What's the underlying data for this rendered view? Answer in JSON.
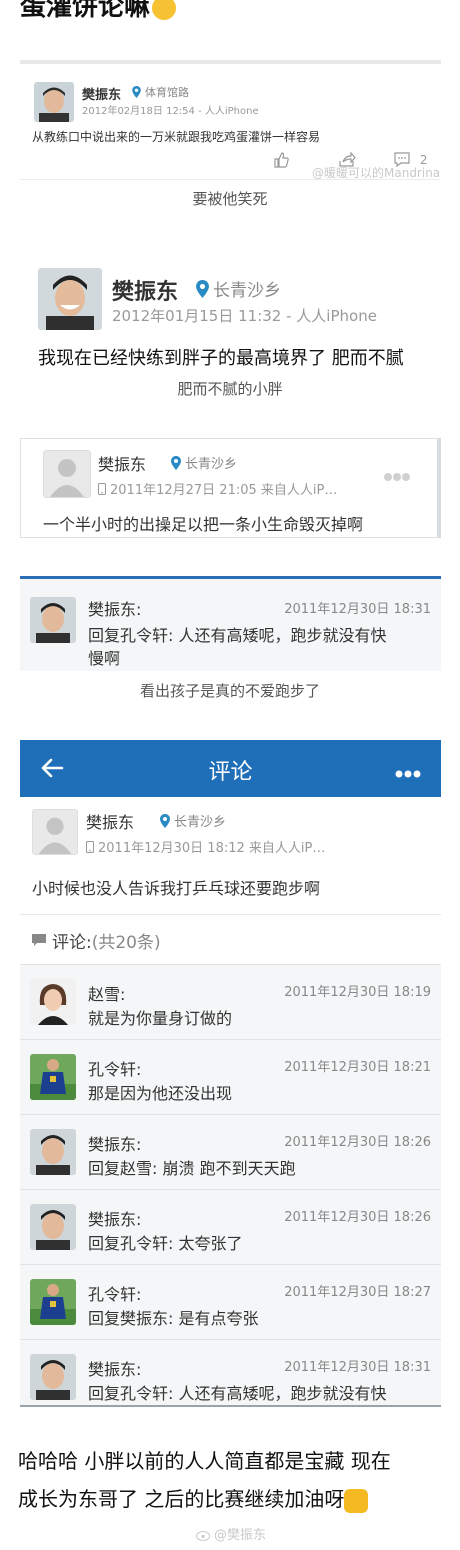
{
  "top_title": "蛋灌饼论嘛",
  "shot1": {
    "name": "樊振东",
    "location": "体育馆路",
    "meta": "2012年02月18日 12:54 - 人人iPhone",
    "text": "从教练口中说出来的一万米就跟我吃鸡蛋灌饼一样容易",
    "comment_count": "2",
    "watermark": "@暖暖可以的Mandrina",
    "icons": [
      "thumbs-up-icon",
      "share-icon",
      "comment-icon"
    ]
  },
  "caption1": "要被他笑死",
  "shot2": {
    "name": "樊振东",
    "location": "长青沙乡",
    "meta": "2012年01月15日 11:32 - 人人iPhone",
    "text": "我现在已经快练到胖子的最高境界了 肥而不腻"
  },
  "caption2": "肥而不腻的小胖",
  "shot3": {
    "name": "樊振东",
    "location": "长青沙乡",
    "meta": "2011年12月27日 21:05 来自人人iP…",
    "text": "一个半小时的出操足以把一条小生命毁灭掉啊"
  },
  "shot4": {
    "name": "樊振东:",
    "time": "2011年12月30日 18:31",
    "line1": "回复孔令轩: 人还有高矮呢，跑步就没有快",
    "line2": "慢啊"
  },
  "caption3": "看出孩子是真的不爱跑步了",
  "shot5": {
    "header_title": "评论",
    "post": {
      "name": "樊振东",
      "location": "长青沙乡",
      "meta": "2011年12月30日 18:12 来自人人iP…",
      "text": "小时候也没人告诉我打乒乓球还要跑步啊"
    },
    "comment_label": "评论:",
    "comment_count": "(共20条)",
    "comments": [
      {
        "name": "赵雪:",
        "time": "2011年12月30日 18:19",
        "text": "就是为你量身订做的",
        "avatar": "female"
      },
      {
        "name": "孔令轩:",
        "time": "2011年12月30日 18:21",
        "text": "那是因为他还没出现",
        "avatar": "jersey"
      },
      {
        "name": "樊振东:",
        "time": "2011年12月30日 18:26",
        "text": "回复赵雪: 崩溃 跑不到天天跑",
        "avatar": "face"
      },
      {
        "name": "樊振东:",
        "time": "2011年12月30日 18:26",
        "text": "回复孔令轩: 太夸张了",
        "avatar": "face"
      },
      {
        "name": "孔令轩:",
        "time": "2011年12月30日 18:27",
        "text": "回复樊振东: 是有点夸张",
        "avatar": "jersey"
      },
      {
        "name": "樊振东:",
        "time": "2011年12月30日 18:31",
        "text": "回复孔令轩: 人还有高矮呢，跑步就没有快",
        "avatar": "face"
      }
    ]
  },
  "footer": {
    "line1": "哈哈哈  小胖以前的人人简直都是宝藏  现在",
    "line2": "成长为东哥了   之后的比赛继续加油呀",
    "watermark": "@樊振东"
  },
  "colors": {
    "accent_blue": "#1f6eb8",
    "pin_blue": "#2a8bc4",
    "list_bg": "#f4f6f7",
    "emoji_yellow": "#f6c233"
  }
}
